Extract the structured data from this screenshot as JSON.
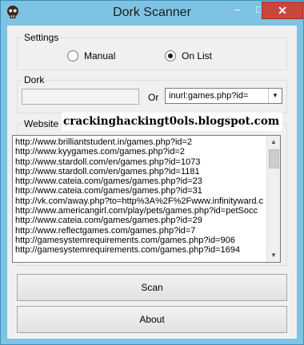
{
  "window": {
    "title": "Dork Scanner",
    "minimize": "–",
    "maximize": "□",
    "close": "✕"
  },
  "settings": {
    "legend": "Settings",
    "options": [
      {
        "label": "Manual",
        "selected": false
      },
      {
        "label": "On List",
        "selected": true
      }
    ]
  },
  "dork": {
    "legend": "Dork",
    "input_value": "",
    "or_label": "Or",
    "combo_value": "inurl:games.php?id="
  },
  "website": {
    "legend": "Website",
    "watermark": "crackinghackingt0ols.blogspot.com",
    "items": [
      "http://www.brilliantstudent.in/games.php?id=2",
      "http://www.kyygames.com/games.php?id=2",
      "http://www.stardoll.com/en/games.php?id=1073",
      "http://www.stardoll.com/en/games.php?id=1181",
      "http://www.cateia.com/games/games.php?id=23",
      "http://www.cateia.com/games/games.php?id=31",
      "http://vk.com/away.php?to=http%3A%2F%2Fwww.infinityward.c",
      "http://www.americangirl.com/play/pets/games.php?id=petSocc",
      "http://www.cateia.com/games/games.php?id=29",
      "http://www.reflectgames.com/games.php?id=7",
      "http://gamesystemrequirements.com/games.php?id=906",
      "http://gamesystemrequirements.com/games.php?id=1694"
    ]
  },
  "buttons": {
    "scan": "Scan",
    "about": "About"
  },
  "icons": {
    "app": "skull-icon"
  }
}
